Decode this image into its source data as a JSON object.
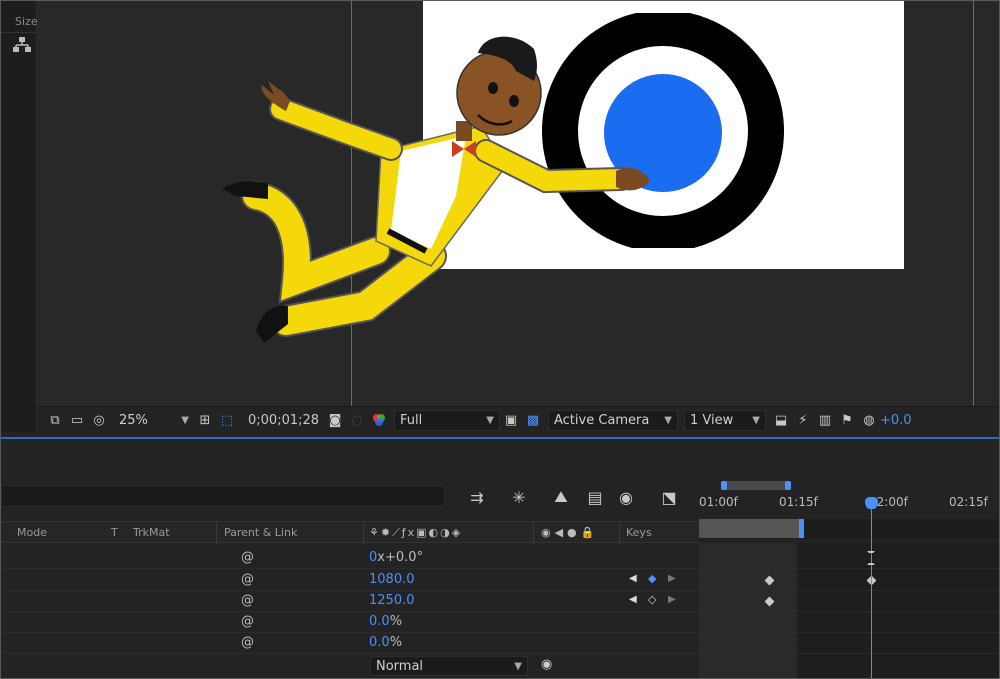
{
  "left_panel": {
    "header": "Size"
  },
  "viewer_toolbar": {
    "zoom": "25%",
    "timecode": "0;00;01;28",
    "resolution": "Full",
    "camera": "Active Camera",
    "views": "1 View",
    "exposure": "+0.0"
  },
  "timeline": {
    "columns": {
      "mode": "Mode",
      "t": "T",
      "trkmat": "TrkMat",
      "parent": "Parent & Link",
      "keys": "Keys"
    },
    "ruler_ticks": [
      "01:00f",
      "01:15f",
      "02:00f",
      "02:15f"
    ],
    "rows": [
      {
        "value": "0",
        "suffix": "x+0.0°"
      },
      {
        "value": "1080.0",
        "suffix": ""
      },
      {
        "value": "1250.0",
        "suffix": ""
      },
      {
        "value": "0.0",
        "suffix": "%"
      },
      {
        "value": "0.0",
        "suffix": "%"
      }
    ],
    "blend_mode": "Normal"
  },
  "colors": {
    "accent": "#2e6cc2",
    "value_blue": "#4a90ff",
    "guide": "#5d5fd6",
    "target_blue": "#1a6cf0",
    "suit_yellow": "#f5d80a"
  }
}
